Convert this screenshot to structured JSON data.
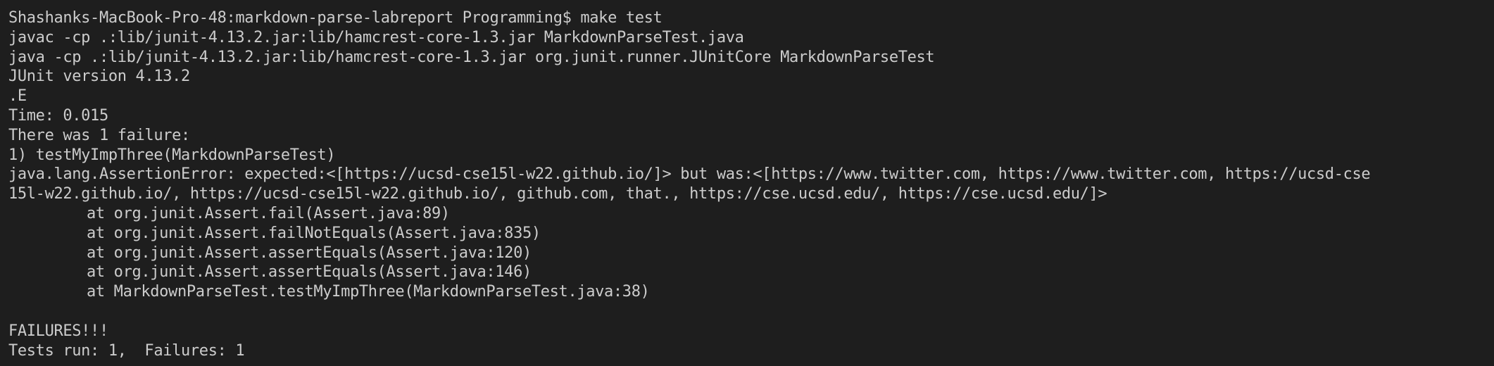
{
  "terminal": {
    "prompt": "Shashanks-MacBook-Pro-48:markdown-parse-labreport Programming$ make test",
    "compile_cmd": "javac -cp .:lib/junit-4.13.2.jar:lib/hamcrest-core-1.3.jar MarkdownParseTest.java",
    "run_cmd": "java -cp .:lib/junit-4.13.2.jar:lib/hamcrest-core-1.3.jar org.junit.runner.JUnitCore MarkdownParseTest",
    "junit_version": "JUnit version 4.13.2",
    "progress": ".E",
    "time": "Time: 0.015",
    "failure_summary": "There was 1 failure:",
    "failure_test": "1) testMyImpThree(MarkdownParseTest)",
    "assertion_error_line1": "java.lang.AssertionError: expected:<[https://ucsd-cse15l-w22.github.io/]> but was:<[https://www.twitter.com, https://www.twitter.com, https://ucsd-cse",
    "assertion_error_line2": "15l-w22.github.io/, https://ucsd-cse15l-w22.github.io/, github.com, that., https://cse.ucsd.edu/, https://cse.ucsd.edu/]>",
    "stack_trace": [
      "at org.junit.Assert.fail(Assert.java:89)",
      "at org.junit.Assert.failNotEquals(Assert.java:835)",
      "at org.junit.Assert.assertEquals(Assert.java:120)",
      "at org.junit.Assert.assertEquals(Assert.java:146)",
      "at MarkdownParseTest.testMyImpThree(MarkdownParseTest.java:38)"
    ],
    "failures_banner": "FAILURES!!!",
    "tests_summary": "Tests run: 1,  Failures: 1"
  },
  "colors": {
    "background": "#1e1e1e",
    "text": "#cccccc"
  }
}
